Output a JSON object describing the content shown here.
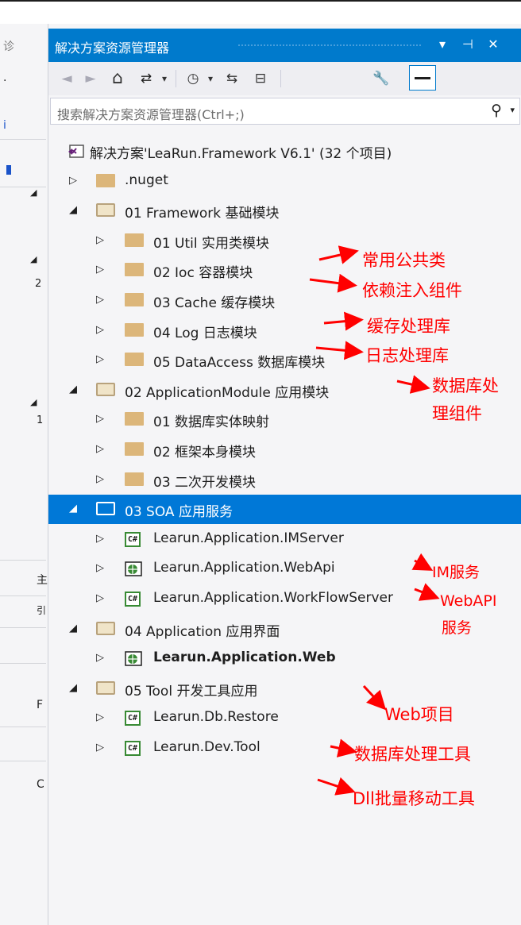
{
  "window": {
    "title": "解决方案资源管理器",
    "dropdown_glyph": "▾",
    "pin_glyph": "⊣",
    "close_glyph": "✕"
  },
  "left_panel": {
    "chars": [
      "诊",
      "·",
      "i",
      "◢",
      "◢",
      "2",
      "◢",
      "1",
      "主",
      "引",
      "F",
      "C"
    ]
  },
  "toolbar": {
    "back": "◄",
    "forward": "►",
    "home": "⌂",
    "sync": "⇄",
    "dropdown": "▾",
    "history": "◷",
    "refresh": "⇆",
    "collapse": "⊟",
    "properties": "🔧",
    "pin": "—"
  },
  "search": {
    "placeholder": "搜索解决方案资源管理器(Ctrl+;)",
    "icon": "⚲",
    "caret": "▾"
  },
  "tree": [
    {
      "label": "解决方案'LeaRun.Framework V6.1' (32 个项目)",
      "icon": "solution",
      "indent": 0,
      "expander": ""
    },
    {
      "label": ".nuget",
      "icon": "folder",
      "indent": 1,
      "expander": "▷"
    },
    {
      "label": "01 Framework 基础模块",
      "icon": "folder-open",
      "indent": 1,
      "expander": "◢"
    },
    {
      "label": "01 Util 实用类模块",
      "icon": "folder",
      "indent": 2,
      "expander": "▷"
    },
    {
      "label": "02 Ioc 容器模块",
      "icon": "folder",
      "indent": 2,
      "expander": "▷"
    },
    {
      "label": "03 Cache 缓存模块",
      "icon": "folder",
      "indent": 2,
      "expander": "▷"
    },
    {
      "label": "04 Log 日志模块",
      "icon": "folder",
      "indent": 2,
      "expander": "▷"
    },
    {
      "label": "05 DataAccess 数据库模块",
      "icon": "folder",
      "indent": 2,
      "expander": "▷"
    },
    {
      "label": "02 ApplicationModule 应用模块",
      "icon": "folder-open",
      "indent": 1,
      "expander": "◢"
    },
    {
      "label": "01 数据库实体映射",
      "icon": "folder",
      "indent": 2,
      "expander": "▷"
    },
    {
      "label": "02 框架本身模块",
      "icon": "folder",
      "indent": 2,
      "expander": "▷"
    },
    {
      "label": "03 二次开发模块",
      "icon": "folder",
      "indent": 2,
      "expander": "▷"
    },
    {
      "label": "03 SOA 应用服务",
      "icon": "folder-open",
      "indent": 1,
      "expander": "◢",
      "selected": true
    },
    {
      "label": "Learun.Application.IMServer",
      "icon": "cs",
      "indent": 2,
      "expander": "▷"
    },
    {
      "label": "Learun.Application.WebApi",
      "icon": "web",
      "indent": 2,
      "expander": "▷"
    },
    {
      "label": "Learun.Application.WorkFlowServer",
      "icon": "cs",
      "indent": 2,
      "expander": "▷"
    },
    {
      "label": "04 Application 应用界面",
      "icon": "folder-open",
      "indent": 1,
      "expander": "◢"
    },
    {
      "label": "Learun.Application.Web",
      "icon": "web",
      "indent": 2,
      "expander": "▷",
      "bold": true
    },
    {
      "label": "05 Tool 开发工具应用",
      "icon": "folder-open",
      "indent": 1,
      "expander": "◢"
    },
    {
      "label": "Learun.Db.Restore",
      "icon": "cs",
      "indent": 2,
      "expander": "▷"
    },
    {
      "label": "Learun.Dev.Tool",
      "icon": "cs",
      "indent": 2,
      "expander": "▷"
    }
  ],
  "cs_icon_text": "C#",
  "annotations": [
    {
      "text": "常用公共类"
    },
    {
      "text": "依赖注入组件"
    },
    {
      "text": "缓存处理库"
    },
    {
      "text": "日志处理库"
    },
    {
      "text": "数据库处"
    },
    {
      "text": "理组件"
    },
    {
      "text": "IM服务"
    },
    {
      "text": "WebAPI"
    },
    {
      "text": "服务"
    },
    {
      "text": "Web项目"
    },
    {
      "text": "数据库处理工具"
    },
    {
      "text": "Dll批量移动工具"
    }
  ],
  "colors": {
    "titlebar": "#007acc",
    "selection": "#0078d7",
    "annotation": "#ff0000",
    "folder": "#dcb67a",
    "cs_border": "#388a34"
  }
}
